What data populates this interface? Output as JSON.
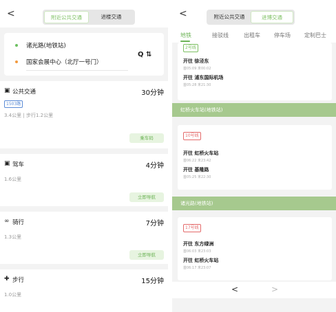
{
  "left": {
    "back_icon": "chevron-left-icon",
    "back_glyph": "<",
    "segment": {
      "nearby": "附近公共交通",
      "transit": "进楼交通"
    },
    "route": {
      "origin": "诸光路(地铁站)",
      "destination": "国家会展中心（北厅一号门）",
      "search_glyph": "Q",
      "swap_glyph": "⇅"
    },
    "modes": {
      "transit": {
        "icon": "bus-icon",
        "glyph": "▣",
        "name": "公共交通",
        "time": "30分钟",
        "line": "1503路",
        "dist": "3.4公里  |  步行1.2公里",
        "btn": "乘车码"
      },
      "drive": {
        "icon": "car-icon",
        "glyph": "▣",
        "name": "驾车",
        "time": "4分钟",
        "dist": "1.6公里",
        "btn": "立即导航"
      },
      "bike": {
        "icon": "bike-icon",
        "glyph": "∞",
        "name": "骑行",
        "time": "7分钟",
        "dist": "1.3公里",
        "btn": "立即导航"
      },
      "walk": {
        "icon": "walk-icon",
        "glyph": "✚",
        "name": "步行",
        "time": "15分钟",
        "dist": "1.0公里"
      }
    }
  },
  "right": {
    "back_glyph": "<",
    "segment": {
      "nearby": "附近公共交通",
      "transit": "进博交通"
    },
    "tabs": [
      "地铁",
      "接驳线",
      "出租车",
      "停车场",
      "定制巴士"
    ],
    "top_block": {
      "tag": "2号线",
      "d1": "开往 徐泾东",
      "t1": "首05:09 末00:02",
      "d2": "开往 浦东国际机场",
      "t2": "首05:28 末21:30"
    },
    "section1": "虹桥火车站(地铁站)",
    "block1": {
      "tag": "10号线",
      "d1": "开往 虹桥火车站",
      "t1": "首06:22 末23:42",
      "d2": "开往 基隆路",
      "t2": "首05:25 末22:30"
    },
    "section2": "诸光路(地铁站)",
    "block2": {
      "tag": "17号线",
      "d1": "开往 东方绿洲",
      "t1": "首06:03 末23:03",
      "d2": "开往 虹桥火车站",
      "t2": "首06:17 末23:07"
    },
    "pager": {
      "prev": "<",
      "next": ">"
    }
  }
}
